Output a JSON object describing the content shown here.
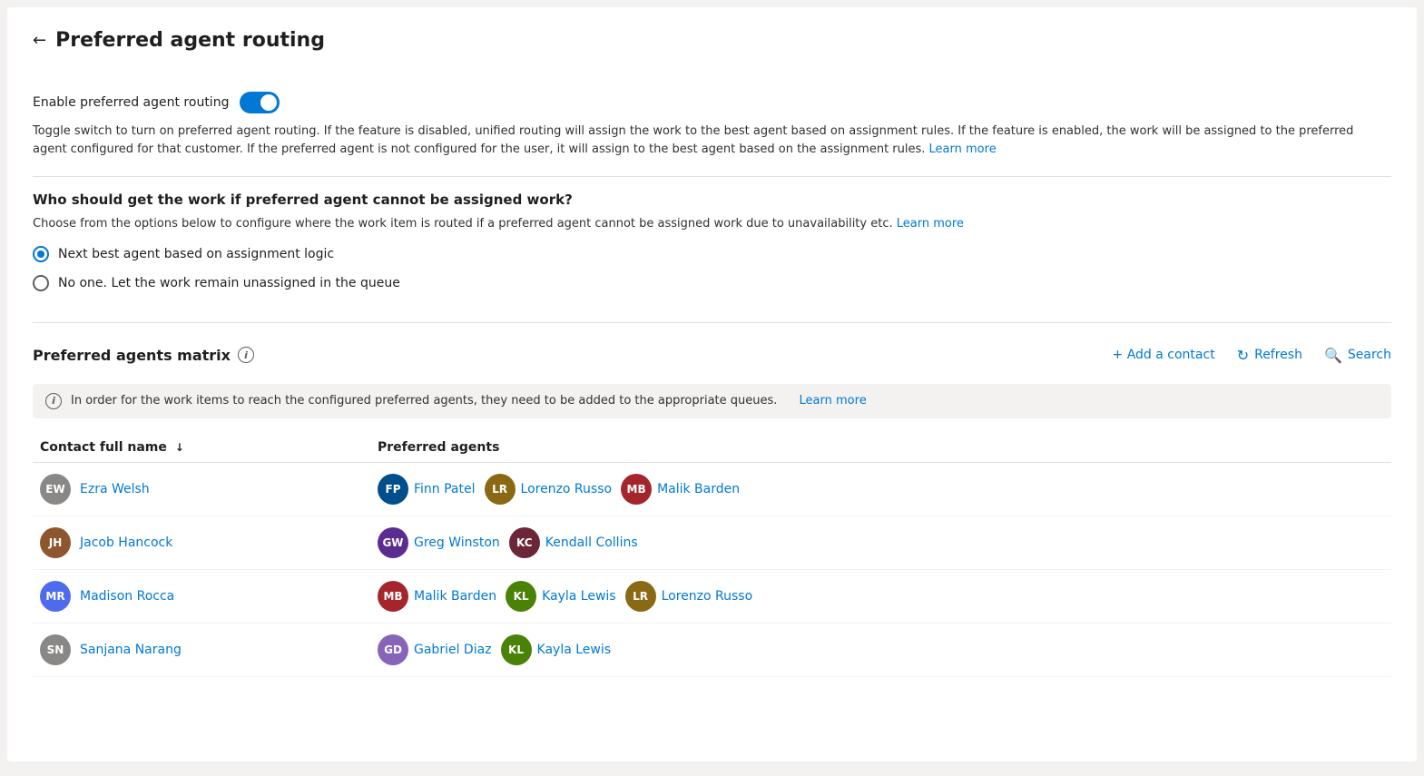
{
  "page": {
    "title": "Preferred agent routing",
    "back_label": "←"
  },
  "enable_section": {
    "label": "Enable preferred agent routing",
    "toggle_on": true,
    "description": "Toggle switch to turn on preferred agent routing. If the feature is disabled, unified routing will assign the work to the best agent based on assignment rules. If the feature is enabled, the work will be assigned to the preferred agent configured for that customer. If the preferred agent is not configured for the user, it will assign to the best agent based on the assignment rules.",
    "learn_more": "Learn more"
  },
  "fallback_section": {
    "title": "Who should get the work if preferred agent cannot be assigned work?",
    "description": "Choose from the options below to configure where the work item is routed if a preferred agent cannot be assigned work due to unavailability etc.",
    "learn_more": "Learn more",
    "options": [
      {
        "label": "Next best agent based on assignment logic",
        "selected": true
      },
      {
        "label": "No one. Let the work remain unassigned in the queue",
        "selected": false
      }
    ]
  },
  "matrix": {
    "title": "Preferred agents matrix",
    "info_icon": "i",
    "add_contact_label": "+ Add a contact",
    "refresh_label": "Refresh",
    "search_label": "Search",
    "info_bar": "In order for the work items to reach the configured preferred agents, they need to be added to the appropriate queues.",
    "info_bar_learn_more": "Learn more",
    "columns": [
      {
        "label": "Contact full name",
        "sort": "↓"
      },
      {
        "label": "Preferred agents"
      }
    ],
    "rows": [
      {
        "contact": {
          "name": "Ezra Welsh",
          "initials": "EW",
          "color": "#8a8886"
        },
        "agents": [
          {
            "name": "Finn Patel",
            "initials": "FP",
            "color": "#004e8c"
          },
          {
            "name": "Lorenzo Russo",
            "initials": "LR",
            "color": "#8a6914"
          },
          {
            "name": "Malik Barden",
            "initials": "MB",
            "color": "#a4262c"
          }
        ]
      },
      {
        "contact": {
          "name": "Jacob Hancock",
          "initials": "JH",
          "color": "#8e562e"
        },
        "agents": [
          {
            "name": "Greg Winston",
            "initials": "GW",
            "color": "#5c2d91"
          },
          {
            "name": "Kendall Collins",
            "initials": "KC",
            "color": "#6b2737"
          }
        ]
      },
      {
        "contact": {
          "name": "Madison Rocca",
          "initials": "MR",
          "color": "#4f6bed"
        },
        "agents": [
          {
            "name": "Malik Barden",
            "initials": "MB",
            "color": "#a4262c"
          },
          {
            "name": "Kayla Lewis",
            "initials": "KL",
            "color": "#498205"
          },
          {
            "name": "Lorenzo Russo",
            "initials": "LR",
            "color": "#8a6914"
          }
        ]
      },
      {
        "contact": {
          "name": "Sanjana Narang",
          "initials": "SN",
          "color": "#8a8886"
        },
        "agents": [
          {
            "name": "Gabriel Diaz",
            "initials": "GD",
            "color": "#8764b8"
          },
          {
            "name": "Kayla Lewis",
            "initials": "KL",
            "color": "#498205"
          }
        ]
      }
    ]
  }
}
